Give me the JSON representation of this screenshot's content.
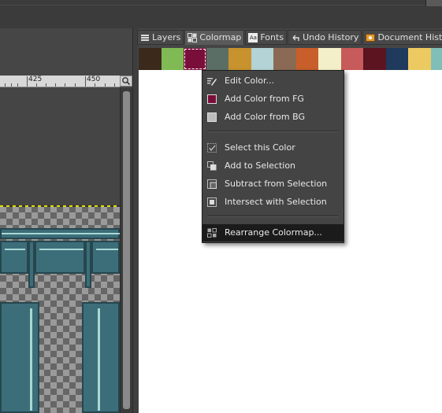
{
  "dock": {
    "tabs": [
      {
        "label": "Layers",
        "icon": "layers-icon"
      },
      {
        "label": "Colormap",
        "icon": "colormap-icon",
        "active": true
      },
      {
        "label": "Fonts",
        "icon": "fonts-icon"
      },
      {
        "label": "Undo History",
        "icon": "undo-history-icon"
      },
      {
        "label": "Document History",
        "icon": "document-history-icon"
      }
    ],
    "font_icon_text": "Aa"
  },
  "ruler": {
    "labels": [
      "425",
      "450"
    ]
  },
  "colormap": {
    "colors": [
      "#3b2a1c",
      "#7fba55",
      "#7a0e3a",
      "#5a6e66",
      "#c8922e",
      "#b3d3d6",
      "#8a6a54",
      "#c85e2a",
      "#f3efc9",
      "#c75a5a",
      "#5b1420",
      "#1f3a5c",
      "#ecc961",
      "#7fbfb8"
    ],
    "selected_index": 2
  },
  "context_menu": {
    "items": [
      {
        "label": "Edit Color...",
        "icon": "edit-color-icon"
      },
      {
        "label": "Add Color from FG",
        "icon": "fg-color-swatch-icon",
        "swatch": "#7a0e3a"
      },
      {
        "label": "Add Color from BG",
        "icon": "bg-color-swatch-icon",
        "swatch": "#bdbdbd"
      },
      {
        "label": "Select this Color",
        "icon": "select-color-icon"
      },
      {
        "label": "Add to Selection",
        "icon": "add-selection-icon"
      },
      {
        "label": "Subtract from Selection",
        "icon": "subtract-selection-icon"
      },
      {
        "label": "Intersect with Selection",
        "icon": "intersect-selection-icon"
      },
      {
        "label": "Rearrange Colormap...",
        "icon": "rearrange-colormap-icon",
        "highlighted": true
      }
    ]
  }
}
